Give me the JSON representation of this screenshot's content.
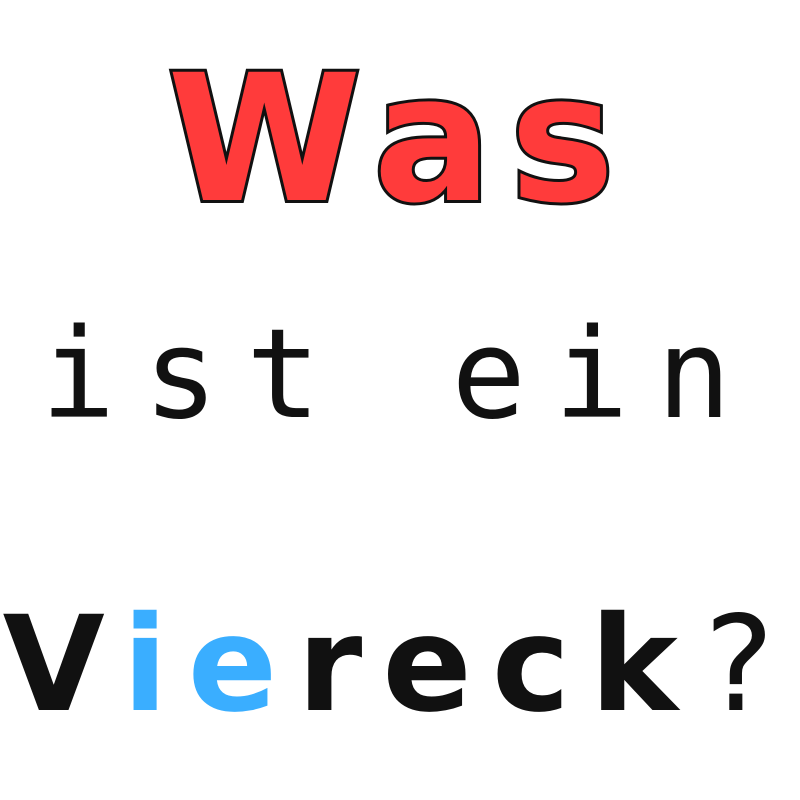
{
  "title": "Was",
  "middle": "ist ein",
  "bottom": {
    "part1": "V",
    "part2": "ie",
    "part3": "reck",
    "part4": "?"
  },
  "colors": {
    "title_fill": "#ff3b3b",
    "outline": "#111111",
    "text": "#111111",
    "highlight": "#3aaeff",
    "background": "#ffffff"
  }
}
